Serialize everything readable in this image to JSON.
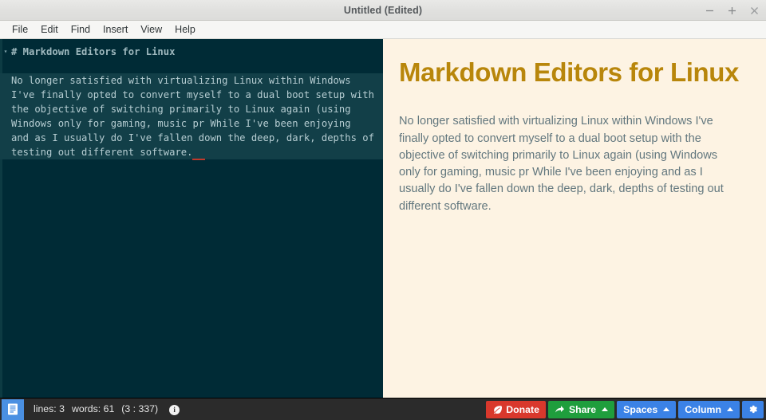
{
  "window": {
    "title": "Untitled (Edited)",
    "controls": [
      {
        "name": "minimize-button",
        "glyph": "−"
      },
      {
        "name": "maximize-button",
        "glyph": "+"
      },
      {
        "name": "close-button",
        "glyph": "×"
      }
    ]
  },
  "menubar": {
    "items": [
      {
        "id": "file",
        "label": "File"
      },
      {
        "id": "edit",
        "label": "Edit"
      },
      {
        "id": "find",
        "label": "Find"
      },
      {
        "id": "insert",
        "label": "Insert"
      },
      {
        "id": "view",
        "label": "View"
      },
      {
        "id": "help",
        "label": "Help"
      }
    ]
  },
  "editor": {
    "fold_arrow": "▾",
    "heading_line": "# Markdown Editors for Linux",
    "paragraph": "No longer satisfied with virtualizing Linux within Windows I've finally opted to convert myself to a dual boot setup with the objective of switching primarily to Linux again (using Windows only for gaming, music pr While I've been enjoying  and as I usually do I've fallen down the deep, dark, depths of testing out different software.",
    "background_color": "#002b36",
    "selection_color": "#123f48",
    "text_color": "#b6cdd2",
    "heading_color": "#9fb9bf"
  },
  "preview": {
    "heading": "Markdown Editors for Linux",
    "paragraph": "No longer satisfied with virtualizing Linux within Windows I've finally opted to convert myself to a dual boot setup with the objective of switching primarily to Linux again (using Windows only for gaming, music pr While I've been enjoying and as I usually do I've fallen down the deep, dark, depths of testing out different software.",
    "background_color": "#fdf3e3",
    "heading_color": "#b8860b",
    "text_color": "#62777e"
  },
  "statusbar": {
    "doc_icon": "document-icon",
    "lines_label": "lines: 3",
    "words_label": "words: 61",
    "position_label": "(3 : 337)",
    "info_icon_glyph": "i",
    "background_color": "#2b2b2b",
    "buttons": [
      {
        "id": "donate",
        "label": "Donate",
        "icon": "leaf-icon",
        "color": "#d9382c",
        "caret": false
      },
      {
        "id": "share",
        "label": "Share",
        "icon": "share-arrow-icon",
        "color": "#1f9e3d",
        "caret": true
      },
      {
        "id": "spaces",
        "label": "Spaces",
        "icon": null,
        "color": "#3b82e6",
        "caret": true
      },
      {
        "id": "column",
        "label": "Column",
        "icon": null,
        "color": "#3b82e6",
        "caret": true
      },
      {
        "id": "settings",
        "label": "",
        "icon": "gear-icon",
        "color": "#3b82e6",
        "caret": false
      }
    ]
  }
}
